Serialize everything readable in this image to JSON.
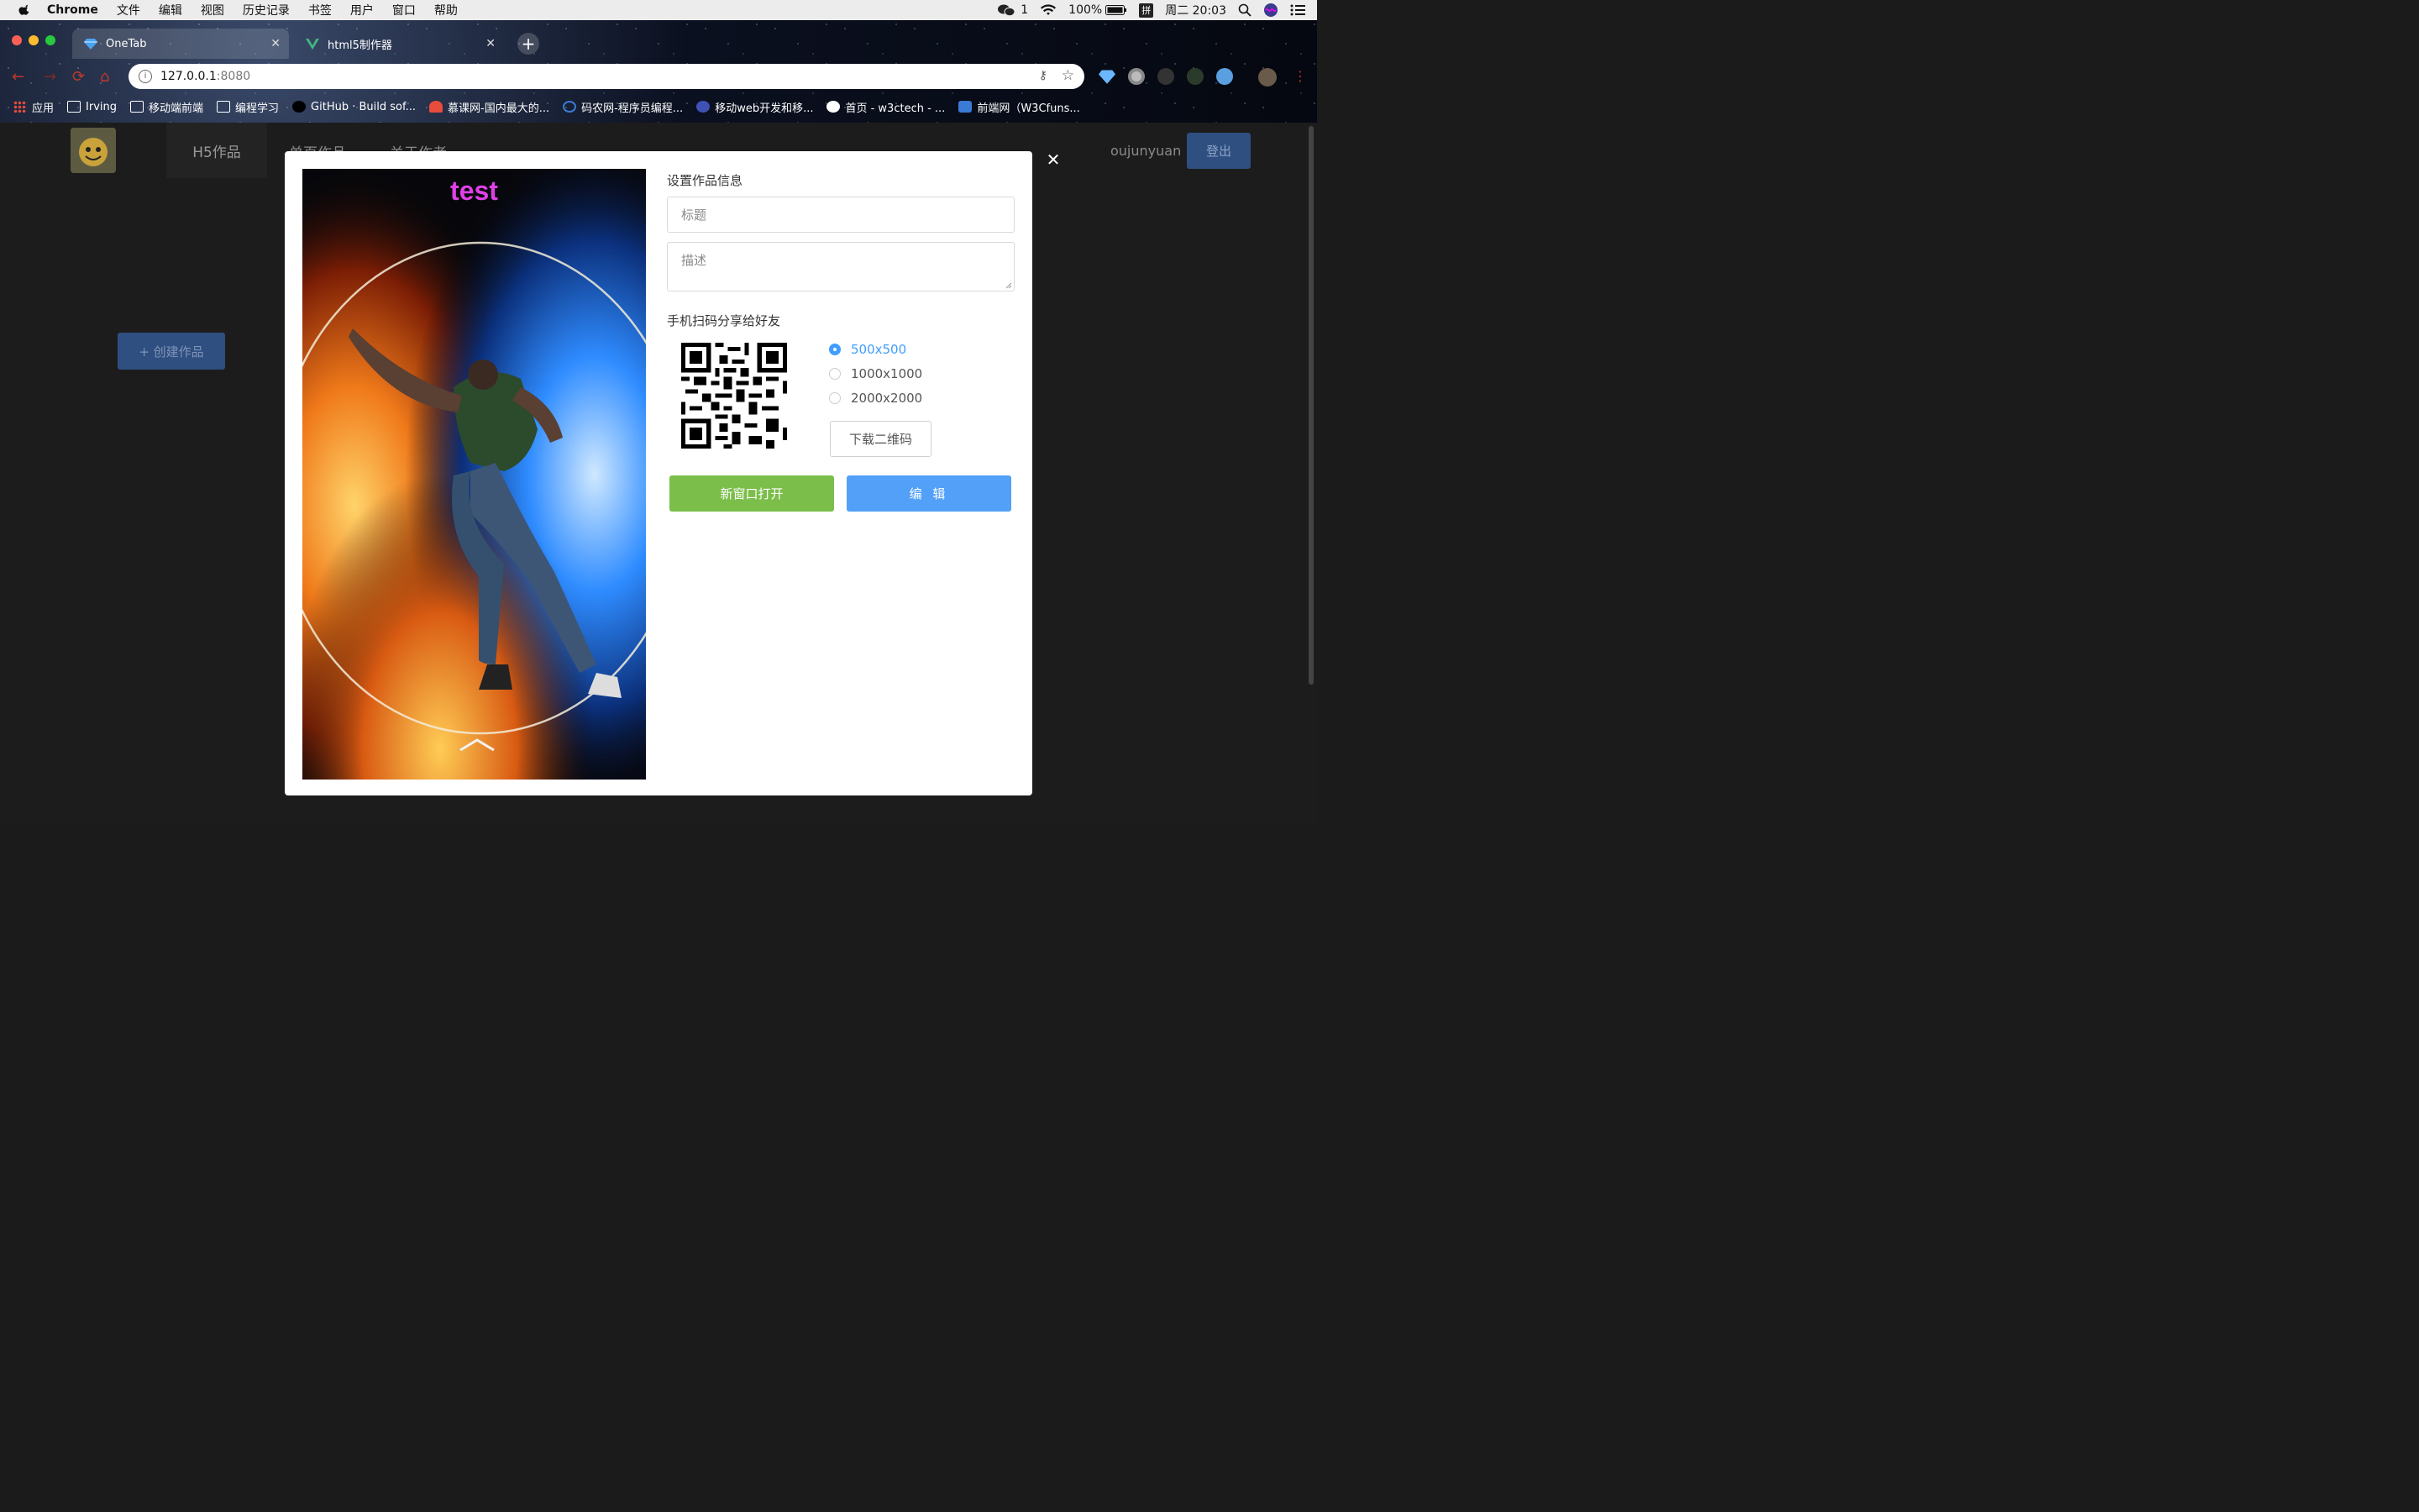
{
  "menubar": {
    "app": "Chrome",
    "items": [
      "文件",
      "编辑",
      "视图",
      "历史记录",
      "书签",
      "用户",
      "窗口",
      "帮助"
    ],
    "wechat_count": "1",
    "battery": "100%",
    "ime": "拼",
    "clock": "周二 20:03"
  },
  "browser": {
    "tabs": [
      {
        "title": "OneTab",
        "active": true
      },
      {
        "title": "html5制作器",
        "active": false
      }
    ],
    "url_host": "127.0.0.1",
    "url_port": ":8080",
    "bookmarks": [
      "应用",
      "Irving",
      "移动端前端",
      "编程学习",
      "GitHub · Build sof...",
      "慕课网-国内最大的...",
      "码农网-程序员编程...",
      "移动web开发和移...",
      "首页 - w3ctech - ...",
      "前端网（W3Cfuns..."
    ]
  },
  "app": {
    "nav": [
      "H5作品",
      "单页作品",
      "关于作者"
    ],
    "username": "oujunyuan",
    "logout": "登出",
    "create": "+ 创建作品"
  },
  "modal": {
    "preview_title": "test",
    "section_info": "设置作品信息",
    "title_placeholder": "标题",
    "desc_placeholder": "描述",
    "section_share": "手机扫码分享给好友",
    "qr_sizes": [
      {
        "label": "500x500",
        "checked": true
      },
      {
        "label": "1000x1000",
        "checked": false
      },
      {
        "label": "2000x2000",
        "checked": false
      }
    ],
    "download_qr": "下载二维码",
    "open_new_window": "新窗口打开",
    "edit": "编 辑"
  },
  "colors": {
    "primary": "#52a0f7",
    "success": "#7bbe4a",
    "title_magenta": "#e040e8"
  }
}
